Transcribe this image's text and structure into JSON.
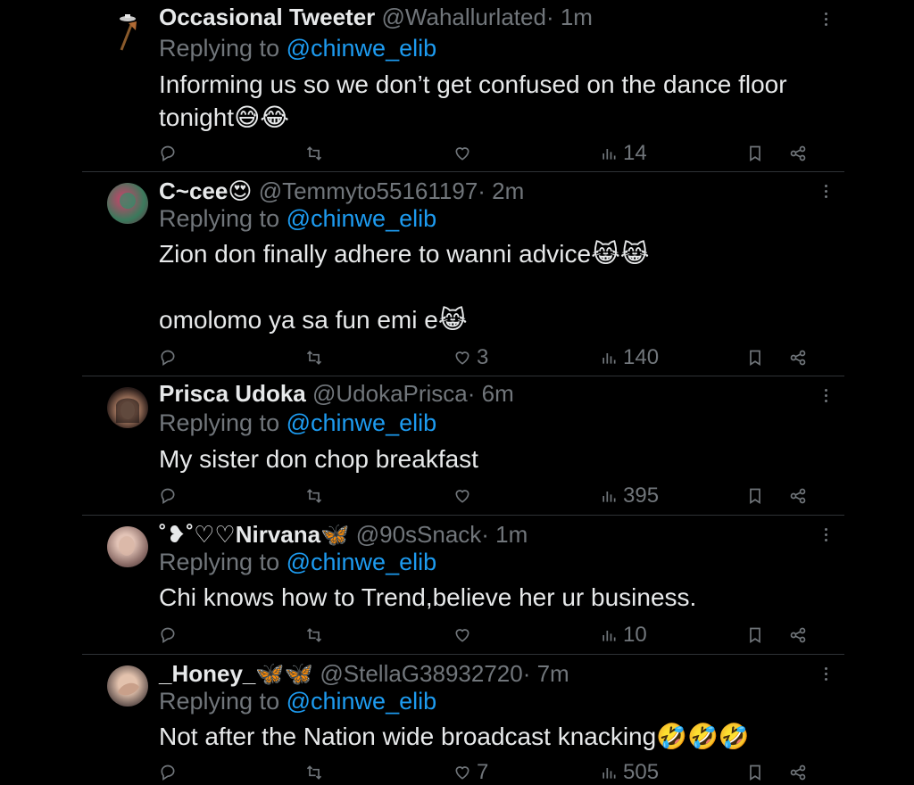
{
  "replying_to_label": "Replying to",
  "tweets": [
    {
      "name": "Occasional Tweeter",
      "name_emoji": "",
      "handle": "@Wahallurlated",
      "time": "· 1m",
      "mention": "@chinwe_elib",
      "text": "Informing us so we don’t get confused on the dance floor tonight😅😂",
      "replies": "",
      "reposts": "",
      "likes": "",
      "views": "14",
      "avatar": "axe-icon"
    },
    {
      "name": "C~cee",
      "name_emoji": "😍",
      "handle": "@Temmyto55161197",
      "time": "· 2m",
      "mention": "@chinwe_elib",
      "text": "Zion don finally adhere to wanni advice😹😹\n\nomolomo ya sa fun emi e😹",
      "replies": "",
      "reposts": "",
      "likes": "3",
      "views": "140",
      "avatar": "profile-photo"
    },
    {
      "name": "Prisca Udoka",
      "name_emoji": "",
      "handle": "@UdokaPrisca",
      "time": "· 6m",
      "mention": "@chinwe_elib",
      "text": "My sister don chop breakfast",
      "replies": "",
      "reposts": "",
      "likes": "",
      "views": "395",
      "avatar": "profile-photo"
    },
    {
      "name": "˚❥˚♡♡Nirvana",
      "name_emoji": "🦋",
      "handle": "@90sSnack",
      "time": "· 1m",
      "mention": "@chinwe_elib",
      "text": "Chi knows how to Trend,believe her ur business.",
      "replies": "",
      "reposts": "",
      "likes": "",
      "views": "10",
      "avatar": "profile-photo"
    },
    {
      "name": "_Honey_",
      "name_emoji": "🦋🦋",
      "handle": "@StellaG38932720",
      "time": "· 7m",
      "mention": "@chinwe_elib",
      "text": "Not after the Nation wide broadcast knacking🤣🤣🤣",
      "replies": "",
      "reposts": "",
      "likes": "7",
      "views": "505",
      "avatar": "profile-photo"
    }
  ],
  "colors": {
    "background": "#000000",
    "text": "#e7e9ea",
    "muted": "#71767b",
    "link": "#1d9bf0",
    "divider": "#2f3336"
  }
}
